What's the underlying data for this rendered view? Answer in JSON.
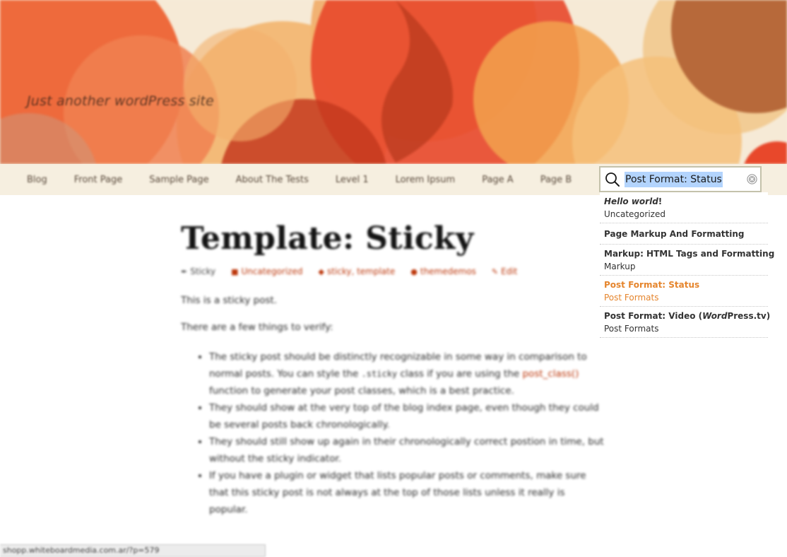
{
  "header": {
    "tagline": "Just another wordPress site"
  },
  "nav": {
    "items": [
      "Blog",
      "Front Page",
      "Sample Page",
      "About The Tests",
      "Level 1",
      "Lorem Ipsum",
      "Page A",
      "Page B"
    ]
  },
  "search": {
    "value": "Post Format: Status",
    "results": [
      {
        "title_em": "Hello world",
        "title_rest": "!",
        "subtitle": "Uncategorized"
      },
      {
        "title": "Page Markup And Formatting"
      },
      {
        "title": "Markup: HTML Tags and Formatting",
        "subtitle": "Markup"
      },
      {
        "title": "Post Format: Status",
        "subtitle": "Post Formats"
      },
      {
        "title_pre": "Post Format: Video (",
        "title_em": "Word",
        "title_post": "Press.tv)",
        "subtitle": "Post Formats"
      }
    ]
  },
  "post": {
    "title": "Template: Sticky",
    "meta": {
      "format": "Sticky",
      "category": "Uncategorized",
      "tags": "sticky, template",
      "author": "themedemos",
      "edit": "Edit"
    },
    "para1": "This is a sticky post.",
    "para2": "There are a few things to verify:",
    "bullet1_a": "The sticky post should be distinctly recognizable in some way in comparison to normal posts. You can style the ",
    "bullet1_code": ".sticky",
    "bullet1_b": " class if you are using the ",
    "bullet1_link": "post_class()",
    "bullet1_c": " function to generate your post classes, which is a best practice.",
    "bullet2": "They should show at the very top of the blog index page, even though they could be several posts back chronologically.",
    "bullet3": "They should still show up again in their chronologically correct postion in time, but without the sticky indicator.",
    "bullet4": "If you have a plugin or widget that lists popular posts or comments, make sure that this sticky post is not always at the top of those lists unless it really is popular."
  },
  "statusbar": {
    "url": "shopp.whiteboardmedia.com.ar/?p=579"
  },
  "colors": {
    "accent": "#bc360a",
    "active_result": "#e5852d",
    "nav_bg": "#f6efe0",
    "selection": "#b3d4fd"
  }
}
